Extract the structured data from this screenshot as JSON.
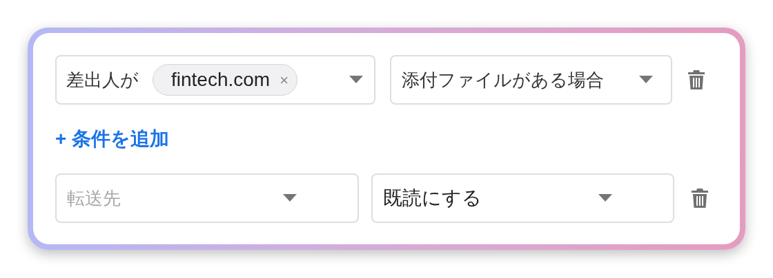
{
  "condition_row": {
    "label": "差出人が",
    "chip": {
      "text": "fintech.com",
      "remove": "×"
    },
    "select": {
      "value": "添付ファイルがある場合"
    }
  },
  "add_condition": "+ 条件を追加",
  "action_row": {
    "target": {
      "placeholder": "転送先"
    },
    "action": {
      "value": "既読にする"
    }
  }
}
